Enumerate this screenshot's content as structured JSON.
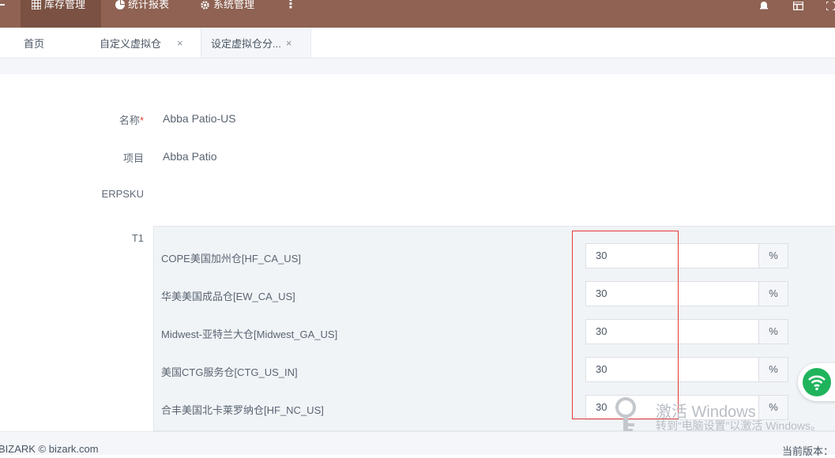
{
  "topnav": {
    "items": [
      {
        "label": "库存管理",
        "icon": "grid-icon"
      },
      {
        "label": "统计报表",
        "icon": "pie-chart-icon"
      },
      {
        "label": "系统管理",
        "icon": "gear-icon"
      }
    ],
    "more_glyph": "⋮",
    "accent": "#8f6253"
  },
  "tabs": [
    {
      "label": "首页"
    },
    {
      "label": "自定义虚拟仓",
      "close": "×"
    },
    {
      "label": "设定虚拟仓分...",
      "close": "×"
    }
  ],
  "form": {
    "name_label": "名称",
    "name_required": "*",
    "name_value": "Abba Patio-US",
    "project_label": "项目",
    "project_value": "Abba Patio",
    "erpsku_label": "ERPSKU",
    "t1_label": "T1"
  },
  "warehouses": [
    {
      "name": "COPE美国加州仓[HF_CA_US]",
      "value": "30",
      "unit": "%"
    },
    {
      "name": "华美美国成品仓[EW_CA_US]",
      "value": "30",
      "unit": "%"
    },
    {
      "name": "Midwest-亚特兰大仓[Midwest_GA_US]",
      "value": "30",
      "unit": "%"
    },
    {
      "name": "美国CTG服务仓[CTG_US_IN]",
      "value": "30",
      "unit": "%"
    },
    {
      "name": "合丰美国北卡莱罗纳仓[HF_NC_US]",
      "value": "30",
      "unit": "%"
    }
  ],
  "footer": {
    "copyright": "BIZARK © bizark.com",
    "version_label": "当前版本："
  },
  "watermark": {
    "title": "激活 Windows",
    "subtitle": "转到“电脑设置”以激活 Windows。"
  }
}
